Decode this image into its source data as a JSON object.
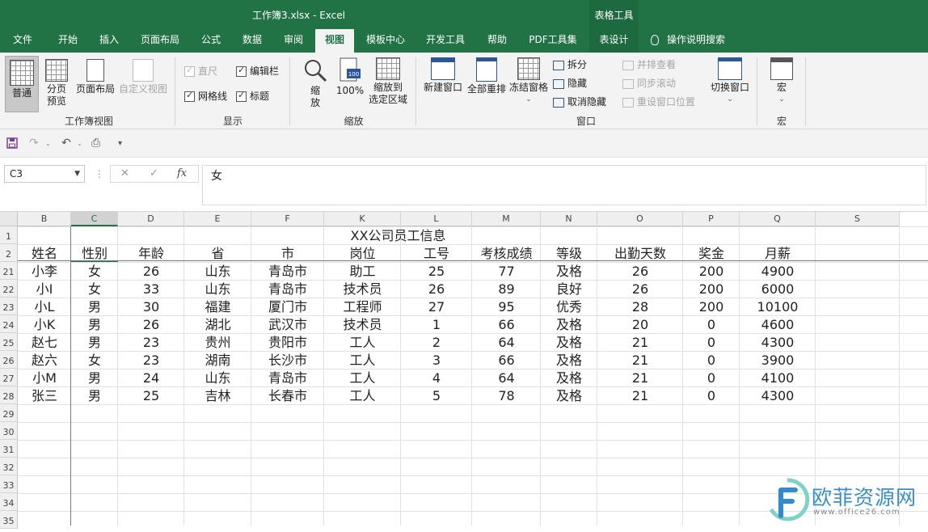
{
  "window": {
    "title": "工作簿3.xlsx  -  Excel",
    "context_group": "表格工具"
  },
  "ribbon_tabs": [
    "文件",
    "开始",
    "插入",
    "页面布局",
    "公式",
    "数据",
    "审阅",
    "视图",
    "模板中心",
    "开发工具",
    "帮助",
    "PDF工具集",
    "表设计"
  ],
  "active_tab": "视图",
  "tell_me": "操作说明搜索",
  "ribbon": {
    "workbook_views": {
      "label": "工作簿视图",
      "normal": "普通",
      "page_break_1": "分页",
      "page_break_2": "预览",
      "page_layout": "页面布局",
      "custom_views": "自定义视图"
    },
    "show": {
      "label": "显示",
      "ruler": "直尺",
      "formula_bar": "编辑栏",
      "gridlines": "网格线",
      "headings": "标题"
    },
    "zoom": {
      "label": "缩放",
      "zoom_1": "缩",
      "zoom_2": "放",
      "zoom_100": "100%",
      "zoom_selection_1": "缩放到",
      "zoom_selection_2": "选定区域"
    },
    "window": {
      "label": "窗口",
      "new_window": "新建窗口",
      "arrange_all": "全部重排",
      "freeze_panes": "冻结窗格",
      "split": "拆分",
      "hide": "隐藏",
      "unhide": "取消隐藏",
      "side_by_side": "并排查看",
      "sync_scroll": "同步滚动",
      "reset_position": "重设窗口位置",
      "switch_windows": "切换窗口"
    },
    "macros": {
      "label": "宏",
      "macros_btn": "宏"
    }
  },
  "formula_bar": {
    "name_box": "C3",
    "formula": "女",
    "cancel_icon": "✕",
    "enter_icon": "✓",
    "fx": "fx"
  },
  "sheet": {
    "columns": [
      "B",
      "C",
      "D",
      "E",
      "F",
      "K",
      "L",
      "M",
      "N",
      "O",
      "P",
      "Q",
      "S"
    ],
    "selected_column": "C",
    "rows": [
      "1",
      "2",
      "21",
      "22",
      "23",
      "24",
      "25",
      "26",
      "27",
      "28",
      "29",
      "30",
      "31",
      "32",
      "33",
      "34",
      "35"
    ],
    "title": "XX公司员工信息",
    "headers": [
      "姓名",
      "性别",
      "年龄",
      "省",
      "市",
      "岗位",
      "工号",
      "考核成绩",
      "等级",
      "出勤天数",
      "奖金",
      "月薪"
    ],
    "data": [
      [
        "小李",
        "女",
        "26",
        "山东",
        "青岛市",
        "助工",
        "25",
        "77",
        "及格",
        "26",
        "200",
        "4900"
      ],
      [
        "小I",
        "女",
        "33",
        "山东",
        "青岛市",
        "技术员",
        "26",
        "89",
        "良好",
        "26",
        "200",
        "6000"
      ],
      [
        "小L",
        "男",
        "30",
        "福建",
        "厦门市",
        "工程师",
        "27",
        "95",
        "优秀",
        "28",
        "200",
        "10100"
      ],
      [
        "小K",
        "男",
        "26",
        "湖北",
        "武汉市",
        "技术员",
        "1",
        "66",
        "及格",
        "20",
        "0",
        "4600"
      ],
      [
        "赵七",
        "男",
        "23",
        "贵州",
        "贵阳市",
        "工人",
        "2",
        "64",
        "及格",
        "21",
        "0",
        "4300"
      ],
      [
        "赵六",
        "女",
        "23",
        "湖南",
        "长沙市",
        "工人",
        "3",
        "66",
        "及格",
        "21",
        "0",
        "3900"
      ],
      [
        "小M",
        "男",
        "24",
        "山东",
        "青岛市",
        "工人",
        "4",
        "64",
        "及格",
        "21",
        "0",
        "4100"
      ],
      [
        "张三",
        "男",
        "25",
        "吉林",
        "长春市",
        "工人",
        "5",
        "78",
        "及格",
        "21",
        "0",
        "4300"
      ]
    ]
  },
  "watermark": {
    "name": "欧菲资源网",
    "url": "www.office26.com"
  }
}
